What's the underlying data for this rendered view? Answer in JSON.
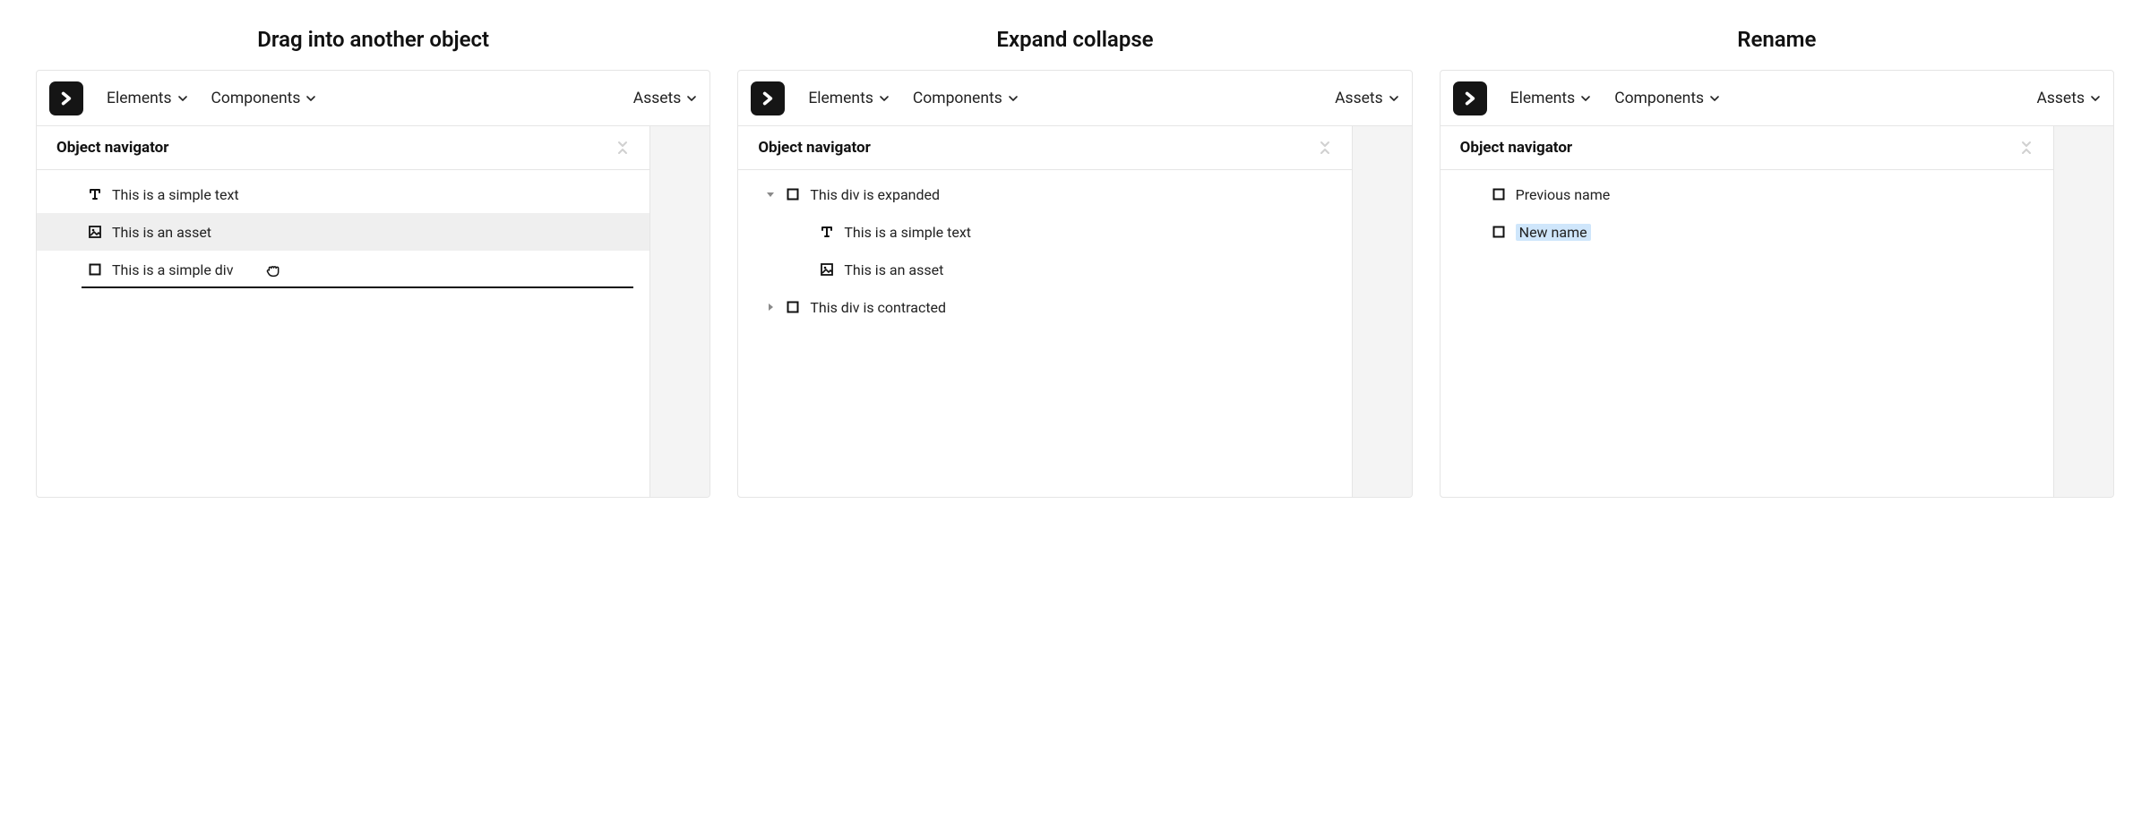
{
  "toolbar": {
    "tabs": {
      "elements": "Elements",
      "components": "Components",
      "assets": "Assets"
    }
  },
  "nav_header": "Object navigator",
  "panels": {
    "drag": {
      "title": "Drag into another object",
      "items": {
        "text": "This is a simple text",
        "asset": "This is an asset",
        "div": "This is a simple div"
      }
    },
    "expand": {
      "title": "Expand collapse",
      "items": {
        "expanded": "This div is expanded",
        "child_text": "This is a simple text",
        "child_asset": "This is an asset",
        "contracted": "This div is contracted"
      }
    },
    "rename": {
      "title": "Rename",
      "items": {
        "prev": "Previous name",
        "new": "New name"
      }
    }
  },
  "icons": {
    "brand": "chevron-right-bold",
    "dropdown": "chevron-down",
    "close": "collapse-x",
    "text": "text-T",
    "asset": "image-asset",
    "square": "square-outline",
    "disclosure_open": "triangle-down",
    "disclosure_closed": "triangle-right",
    "grab": "hand-grab"
  }
}
